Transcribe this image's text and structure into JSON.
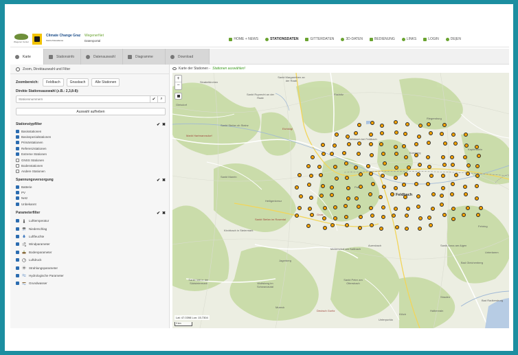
{
  "header": {
    "logos": {
      "partner": "Wegener Center",
      "climate_line1": "Climate Change Graz",
      "climate_line2": "Field of Excellence",
      "portal_line1": "WegenerNet",
      "portal_line2": "Datenportal"
    },
    "nav": [
      {
        "label": "HOME + NEWS",
        "icon": "home-icon",
        "active": false
      },
      {
        "label": "STATIONSDATEN",
        "icon": "chart-icon",
        "active": true
      },
      {
        "label": "GITTERDATEN",
        "icon": "grid-icon",
        "active": false
      },
      {
        "label": "3D-DATEN",
        "icon": "mountain-icon",
        "active": false
      },
      {
        "label": "BEDIENUNG",
        "icon": "info-icon",
        "active": false
      },
      {
        "label": "LINKS",
        "icon": "link-icon",
        "active": false
      },
      {
        "label": "LOGIN",
        "icon": "user-icon",
        "active": false
      },
      {
        "label": "DE|EN",
        "icon": "globe-icon",
        "active": false
      }
    ]
  },
  "tabs": [
    {
      "label": "Karte",
      "icon": "globe-icon",
      "active": true
    },
    {
      "label": "Stationsinfo",
      "icon": "tag-icon",
      "active": false
    },
    {
      "label": "Datenauswahl",
      "icon": "clock-icon",
      "active": false
    },
    {
      "label": "Diagramme",
      "icon": "bar-chart-icon",
      "active": false
    },
    {
      "label": "Download",
      "icon": "download-icon",
      "active": false
    }
  ],
  "panel": {
    "title": "Zoom, Direktauswahl und Filter",
    "zoom_label": "Zoombereich:",
    "zoom_buttons": [
      "Feldbach",
      "Gnasbach",
      "Alle Stationen"
    ],
    "direct_label": "Direkte Stationsauswahl (z.B.: 2,3,8-8):",
    "search_placeholder": "Stationsnummern",
    "clear_button": "Auswahl aufheben",
    "station_filter": {
      "title": "Stationstypfilter",
      "items": [
        {
          "label": "Basisstationen",
          "checked": true
        },
        {
          "label": "Basisspezialstationen",
          "checked": true
        },
        {
          "label": "Primärstationen",
          "checked": true
        },
        {
          "label": "Referenzstationen",
          "checked": true
        },
        {
          "label": "Extreme Stationen",
          "checked": true
        },
        {
          "label": "GNSS Stationen",
          "checked": false
        },
        {
          "label": "Bodenstationen",
          "checked": false
        },
        {
          "label": "Andere Stationen",
          "checked": false
        }
      ]
    },
    "power_filter": {
      "title": "Spannungsversorgung",
      "items": [
        {
          "label": "Batterie",
          "checked": true
        },
        {
          "label": "PV",
          "checked": true
        },
        {
          "label": "Netz",
          "checked": true
        },
        {
          "label": "Unbekannt",
          "checked": true
        }
      ]
    },
    "param_filter": {
      "title": "Parameterfilter",
      "items": [
        {
          "label": "Lufttemperatur",
          "icon": "thermometer-icon",
          "checked": true
        },
        {
          "label": "Niederschlag",
          "icon": "cloud-rain-icon",
          "checked": true
        },
        {
          "label": "Luftfeuchte",
          "icon": "droplet-icon",
          "checked": true
        },
        {
          "label": "Windparameter",
          "icon": "wind-icon",
          "checked": true
        },
        {
          "label": "Bodenparameter",
          "icon": "soil-icon",
          "checked": true
        },
        {
          "label": "Luftdruck",
          "icon": "gauge-icon",
          "checked": true
        },
        {
          "label": "Strahlungsparameter",
          "icon": "sun-icon",
          "checked": true
        },
        {
          "label": "Hydrologische Parameter",
          "icon": "water-icon",
          "checked": true
        },
        {
          "label": "Grundwasser",
          "icon": "groundwater-icon",
          "checked": true
        }
      ]
    },
    "select_all_symbol": "✔",
    "deselect_all_symbol": "✖"
  },
  "map": {
    "header_text": "Karte der Stationen -",
    "header_cta": "Stationen auswählen!",
    "coords": "Lat: 47.0398 Lon: 15.7304",
    "scale": "3 km",
    "labels": [
      {
        "text": "Feldbach",
        "kind": "city"
      },
      {
        "text": "Sankt Margarethen an der Raab",
        "kind": "town"
      },
      {
        "text": "Sankt Ruprecht an der Raab",
        "kind": "town"
      },
      {
        "text": "Sankt Stefan im Rosental",
        "kind": "town"
      },
      {
        "text": "Sankt Veit in der Südsteiermark",
        "kind": "town"
      },
      {
        "text": "Gleisdorf",
        "kind": "town"
      },
      {
        "text": "Kirchbach in Steiermark",
        "kind": "town"
      },
      {
        "text": "Fehring",
        "kind": "town"
      },
      {
        "text": "Riegersburg",
        "kind": "town"
      },
      {
        "text": "Kapfenstein",
        "kind": "town"
      },
      {
        "text": "Gnas",
        "kind": "town"
      },
      {
        "text": "Paldau",
        "kind": "town"
      },
      {
        "text": "Bad Gleichenberg",
        "kind": "town"
      },
      {
        "text": "Straden",
        "kind": "town"
      },
      {
        "text": "Wolfsberg im Schwarzautal",
        "kind": "town"
      },
      {
        "text": "Sankt Peter am Ottersbach",
        "kind": "town"
      },
      {
        "text": "Mureck",
        "kind": "town"
      },
      {
        "text": "Deutsch Goritz",
        "kind": "town"
      },
      {
        "text": "Halbenrain",
        "kind": "town"
      },
      {
        "text": "Unterlamm",
        "kind": "town"
      },
      {
        "text": "Jagerberg",
        "kind": "town"
      },
      {
        "text": "Sankt Anna am Aigen",
        "kind": "town"
      },
      {
        "text": "Klöch",
        "kind": "town"
      },
      {
        "text": "Sankt Stefan ob Stainz",
        "kind": "town"
      },
      {
        "text": "Eichkögl",
        "kind": "town"
      },
      {
        "text": "Fladnitz",
        "kind": "town"
      },
      {
        "text": "Edelsbach bei Feldbach",
        "kind": "town"
      },
      {
        "text": "Kornberg",
        "kind": "town"
      },
      {
        "text": "Auersbach",
        "kind": "town"
      },
      {
        "text": "Mettersdorf am Saßbach",
        "kind": "town"
      },
      {
        "text": "Unterpurkla",
        "kind": "town"
      },
      {
        "text": "Markt Hartmannsdorf",
        "kind": "town"
      },
      {
        "text": "Sankt Marein",
        "kind": "town"
      },
      {
        "text": "Sinabelkirchen",
        "kind": "town"
      },
      {
        "text": "Heiligenkreuz",
        "kind": "town"
      },
      {
        "text": "Bad Radkersburg",
        "kind": "town"
      }
    ],
    "stations_count": 155
  },
  "colors": {
    "border": "#1c8ea0",
    "accent": "#6aa330",
    "station": "#f4a100",
    "map_bg": "#e9ecde",
    "forest": "#c6dba5"
  }
}
